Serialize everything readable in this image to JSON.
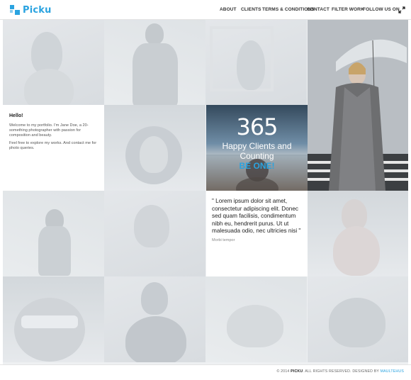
{
  "header": {
    "logo_text": "Picku",
    "nav": [
      "ABOUT",
      "CLIENTS",
      "TERMS & CONDITIONS",
      "CONTACT",
      "FILTER WORK",
      "FOLLOW US ON"
    ],
    "expand_icon": "expand-arrows-icon"
  },
  "intro": {
    "title": "Hello!",
    "paragraph1": "Welcome to my portfolio. I'm Jane Doe, a 20-something photographer with passion for composition and beauty.",
    "paragraph2": "Feel free to explore my works. And contact me for photo queries."
  },
  "counter": {
    "number": "365",
    "line1": "Happy Clients and",
    "line2": "Counting",
    "cta": "BE ONE!"
  },
  "testimonial": {
    "quote": "\" Lorem ipsum dolor sit amet, consectetur adipiscing elit. Donec sed quam facilisis, condimentum nibh eu, hendrerit purus. Ut ut malesuada odio, nec ultricies nisi \"",
    "author": "Morbi tempor"
  },
  "footer": {
    "copyright": "© 2014",
    "brand": "PICKU",
    "rights": ". ALL RIGHTS RESERVED. DESIGNED BY",
    "designer": "MAULTEHUS"
  },
  "colors": {
    "accent": "#2aa3e0",
    "background": "#eef0f2"
  }
}
